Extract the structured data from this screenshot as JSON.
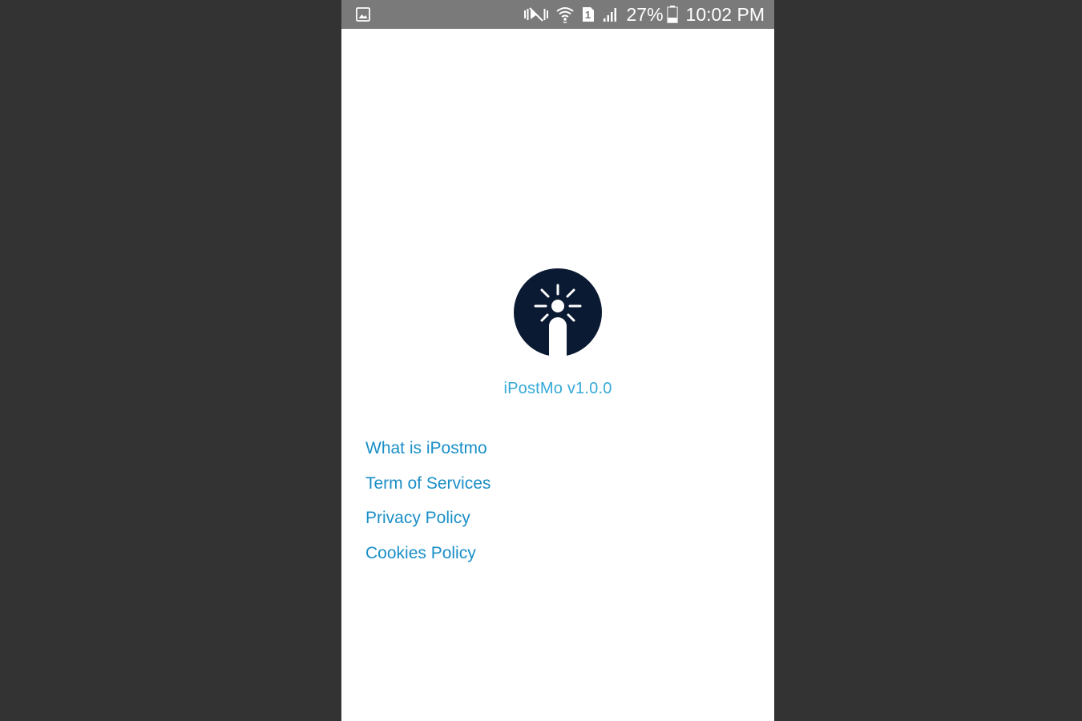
{
  "status_bar": {
    "icons": [
      "gallery-icon",
      "mute-icon",
      "wifi-icon",
      "sim-1-icon",
      "signal-icon",
      "battery-icon"
    ],
    "sim_slot": "1",
    "battery_percent": "27%",
    "time": "10:02 PM",
    "background_color": "#7a7a7a"
  },
  "app": {
    "logo_icon": "ipostmo-logo-icon",
    "logo_color": "#0b1a33",
    "version_label": "iPostMo v1.0.0",
    "accent_color": "#35a9d6"
  },
  "links": [
    {
      "label": "What is iPostmo"
    },
    {
      "label": "Term of Services"
    },
    {
      "label": "Privacy Policy"
    },
    {
      "label": "Cookies Policy"
    }
  ]
}
